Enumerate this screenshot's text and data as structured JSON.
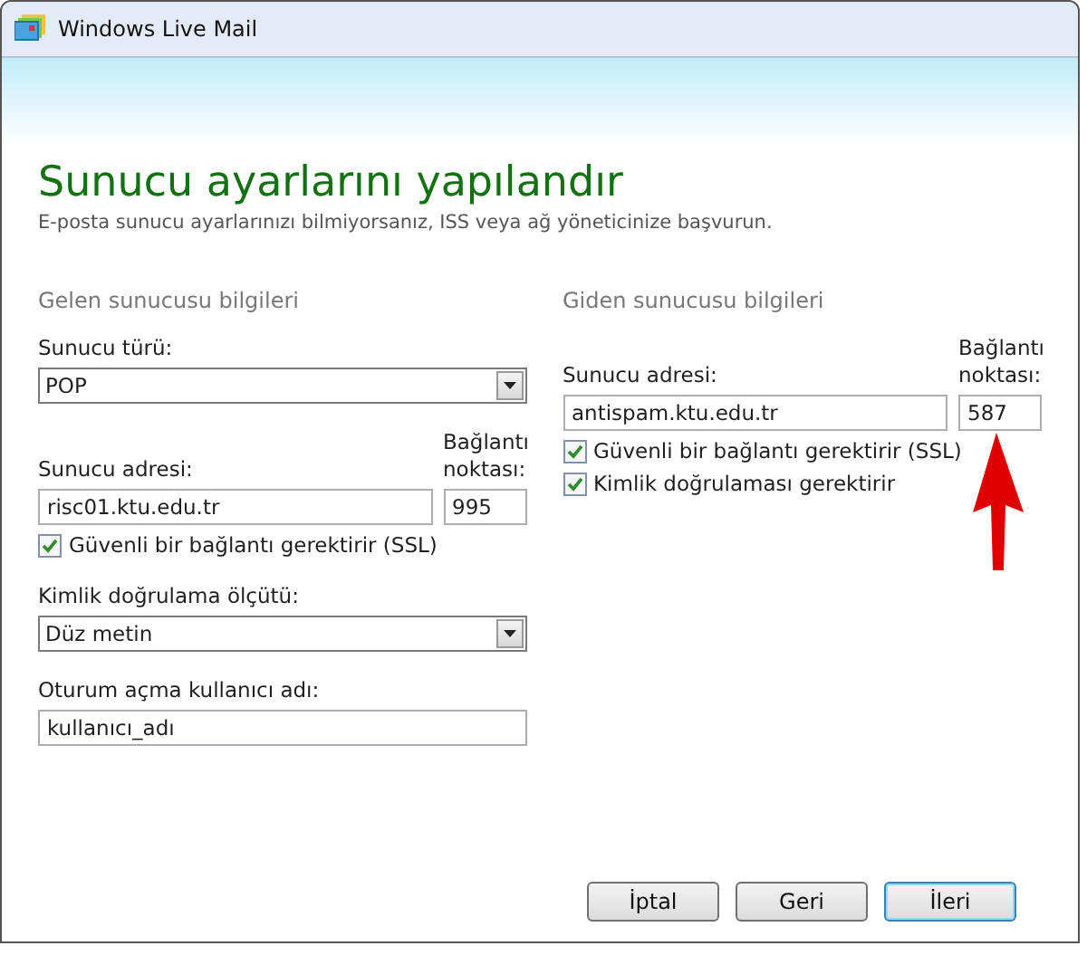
{
  "window": {
    "title": "Windows Live Mail"
  },
  "heading": "Sunucu ayarlarını yapılandır",
  "subtitle": "E-posta sunucu ayarlarınızı bilmiyorsanız, ISS veya ağ yöneticinize başvurun.",
  "incoming": {
    "section_title": "Gelen sunucusu bilgileri",
    "server_type_label": "Sunucu türü:",
    "server_type": "POP",
    "address_label": "Sunucu adresi:",
    "port_label": "Bağlantı noktası:",
    "address": "risc01.ktu.edu.tr",
    "port": "995",
    "options": [
      {
        "label": "Güvenli bir bağlantı gerektirir (SSL)",
        "checked": true
      }
    ],
    "auth_label": "Kimlik doğrulama ölçütü:",
    "auth": "Düz metin",
    "login_label": "Oturum açma kullanıcı adı:",
    "login": "kullanıcı_adı"
  },
  "outgoing": {
    "section_title": "Giden sunucusu bilgileri",
    "address_label": "Sunucu adresi:",
    "port_label": "Bağlantı noktası:",
    "address": "antispam.ktu.edu.tr",
    "port": "587",
    "options": [
      {
        "label": "Güvenli bir bağlantı gerektirir (SSL)",
        "checked": true
      },
      {
        "label": "Kimlik doğrulaması gerektirir",
        "checked": true
      }
    ]
  },
  "buttons": [
    {
      "label": "İptal",
      "focused": false
    },
    {
      "label": "Geri",
      "focused": false
    },
    {
      "label": "İleri",
      "focused": true
    }
  ]
}
